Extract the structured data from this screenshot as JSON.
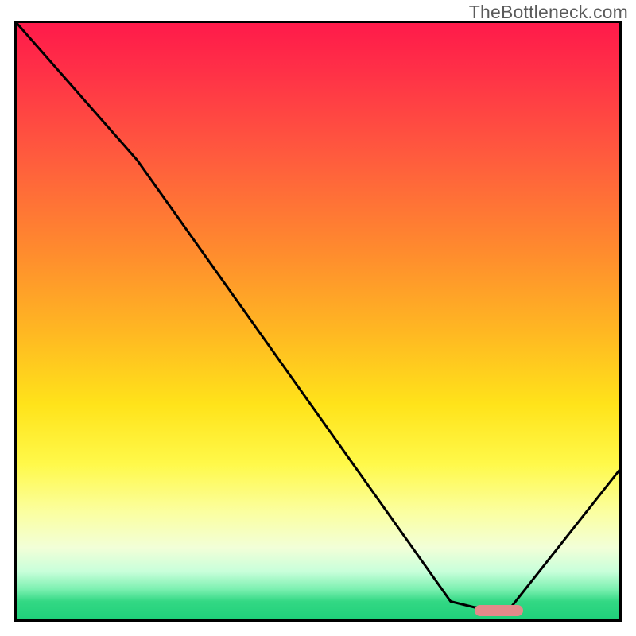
{
  "watermark": "TheBottleneck.com",
  "colors": {
    "border": "#000000",
    "curve": "#000000",
    "marker": "#e38a8a"
  },
  "chart_data": {
    "type": "line",
    "title": "",
    "xlabel": "",
    "ylabel": "",
    "xlim": [
      0,
      100
    ],
    "ylim": [
      0,
      100
    ],
    "x": [
      0,
      20,
      72,
      76,
      82,
      100
    ],
    "values": [
      100,
      77,
      3,
      2,
      2,
      25
    ],
    "marker": {
      "x_start": 76,
      "x_end": 84,
      "y": 1.5
    },
    "note": "x/y in percent of inner plot area; y measured from bottom (0) to top (100). Values estimated from pixels; no axis ticks present in source."
  }
}
